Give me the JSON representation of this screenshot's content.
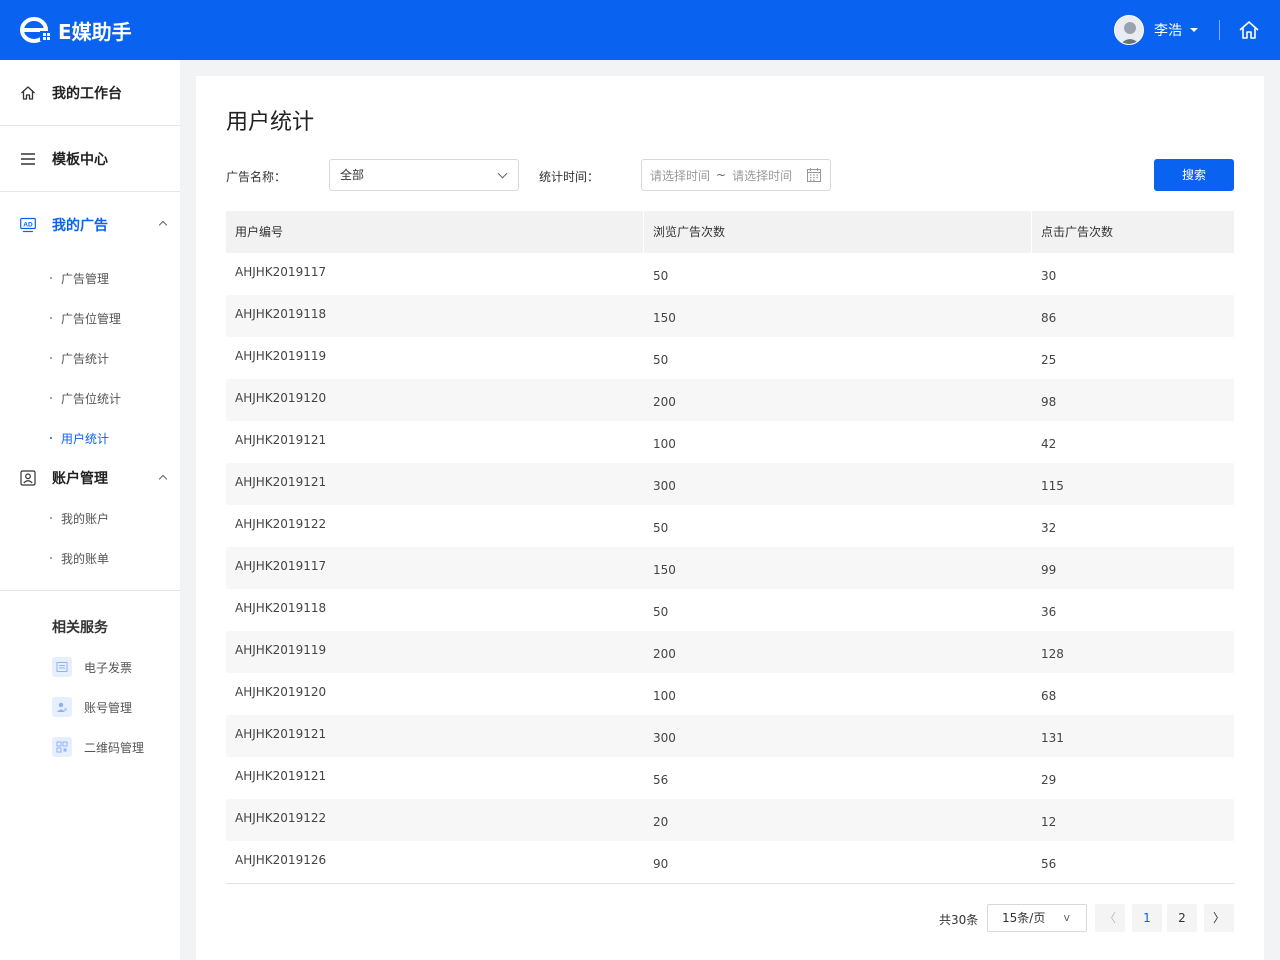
{
  "header": {
    "logo_text": "E媒助手",
    "user_name": "李浩"
  },
  "sidebar": {
    "workbench": "我的工作台",
    "templates": "模板中心",
    "my_ads": {
      "label": "我的广告",
      "icon_text": "AD",
      "items": [
        "广告管理",
        "广告位管理",
        "广告统计",
        "广告位统计",
        "用户统计"
      ]
    },
    "account": {
      "label": "账户管理",
      "items": [
        "我的账户",
        "我的账单"
      ]
    },
    "services": {
      "title": "相关服务",
      "items": [
        "电子发票",
        "账号管理",
        "二维码管理"
      ]
    }
  },
  "main": {
    "title": "用户统计",
    "filters": {
      "ad_name_label": "广告名称：",
      "ad_name_value": "全部",
      "time_label": "统计时间：",
      "start_placeholder": "请选择时间",
      "separator": "~",
      "end_placeholder": "请选择时间",
      "search_label": "搜索"
    },
    "table": {
      "columns": [
        "用户编号",
        "浏览广告次数",
        "点击广告次数"
      ],
      "rows": [
        [
          "AHJHK2019117",
          "50",
          "30"
        ],
        [
          "AHJHK2019118",
          "150",
          "86"
        ],
        [
          "AHJHK2019119",
          "50",
          "25"
        ],
        [
          "AHJHK2019120",
          "200",
          "98"
        ],
        [
          "AHJHK2019121",
          "100",
          "42"
        ],
        [
          "AHJHK2019121",
          "300",
          "115"
        ],
        [
          "AHJHK2019122",
          "50",
          "32"
        ],
        [
          "AHJHK2019117",
          "150",
          "99"
        ],
        [
          "AHJHK2019118",
          "50",
          "36"
        ],
        [
          "AHJHK2019119",
          "200",
          "128"
        ],
        [
          "AHJHK2019120",
          "100",
          "68"
        ],
        [
          "AHJHK2019121",
          "300",
          "131"
        ],
        [
          "AHJHK2019121",
          "56",
          "29"
        ],
        [
          "AHJHK2019122",
          "20",
          "12"
        ],
        [
          "AHJHK2019126",
          "90",
          "56"
        ]
      ]
    },
    "pagination": {
      "total": "共30条",
      "page_size": "15条/页",
      "page_size_caret": "v",
      "prev": "〈",
      "pages": [
        "1",
        "2"
      ],
      "next": "〉"
    }
  },
  "colors": {
    "brand": "#0a62f0",
    "row_alt": "#f7f7f7"
  },
  "icons": {
    "workbench": "home-icon",
    "templates": "menu-icon",
    "my_ads": "ad-icon",
    "account": "account-icon",
    "header_home": "home-icon",
    "services": [
      "invoice-icon",
      "user-account-icon",
      "qrcode-icon"
    ]
  }
}
